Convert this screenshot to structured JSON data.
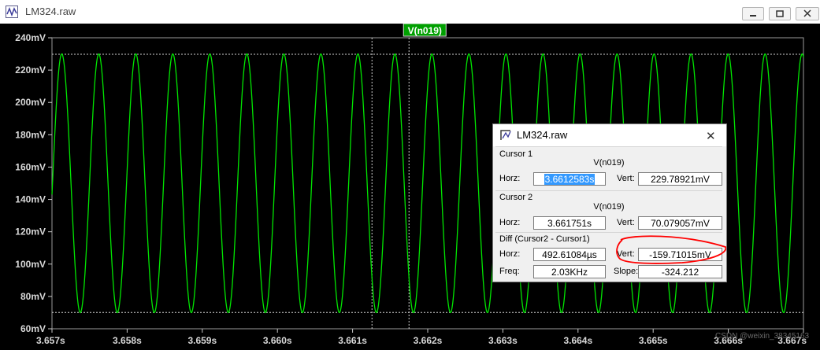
{
  "window": {
    "title": "LM324.raw"
  },
  "trace_label": "V(n019)",
  "colors": {
    "background": "#000000",
    "trace": "#00e600",
    "grid": "#cfcfcf",
    "label_bg": "#00a000",
    "annotation": "#ff0000"
  },
  "chart_data": {
    "type": "line",
    "title": "V(n019)",
    "xlabel": "",
    "ylabel": "",
    "xlim": [
      3.657,
      3.667
    ],
    "ylim": [
      60,
      240
    ],
    "x_ticks": [
      "3.657s",
      "3.658s",
      "3.659s",
      "3.660s",
      "3.661s",
      "3.662s",
      "3.663s",
      "3.664s",
      "3.665s",
      "3.666s",
      "3.667s"
    ],
    "y_ticks": [
      "240mV",
      "220mV",
      "200mV",
      "180mV",
      "160mV",
      "140mV",
      "120mV",
      "100mV",
      "80mV",
      "60mV"
    ],
    "grid": false,
    "series": [
      {
        "name": "V(n019)",
        "type": "sine",
        "offset_mV": 150,
        "amplitude_mV": 80,
        "frequency_hz": 2030,
        "peak_time_s": 3.65713
      }
    ],
    "cursors": [
      {
        "name": "Cursor 1",
        "x": 3.6612583,
        "y_mV": 229.78921
      },
      {
        "name": "Cursor 2",
        "x": 3.661751,
        "y_mV": 70.079057
      }
    ]
  },
  "dialog": {
    "title": "LM324.raw",
    "close_glyph": "✕",
    "cursor1": {
      "title": "Cursor 1",
      "trace": "V(n019)",
      "horz_label": "Horz:",
      "horz": "3.6612583s",
      "vert_label": "Vert:",
      "vert": "229.78921mV"
    },
    "cursor2": {
      "title": "Cursor 2",
      "trace": "V(n019)",
      "horz_label": "Horz:",
      "horz": "3.661751s",
      "vert_label": "Vert:",
      "vert": "70.079057mV"
    },
    "diff": {
      "title": "Diff (Cursor2 - Cursor1)",
      "horz_label": "Horz:",
      "horz": "492.61084µs",
      "vert_label": "Vert:",
      "vert": "-159.71015mV",
      "freq_label": "Freq:",
      "freq": "2.03KHz",
      "slope_label": "Slope:",
      "slope": "-324.212"
    }
  },
  "watermark": "CSDN @weixin_38345163"
}
